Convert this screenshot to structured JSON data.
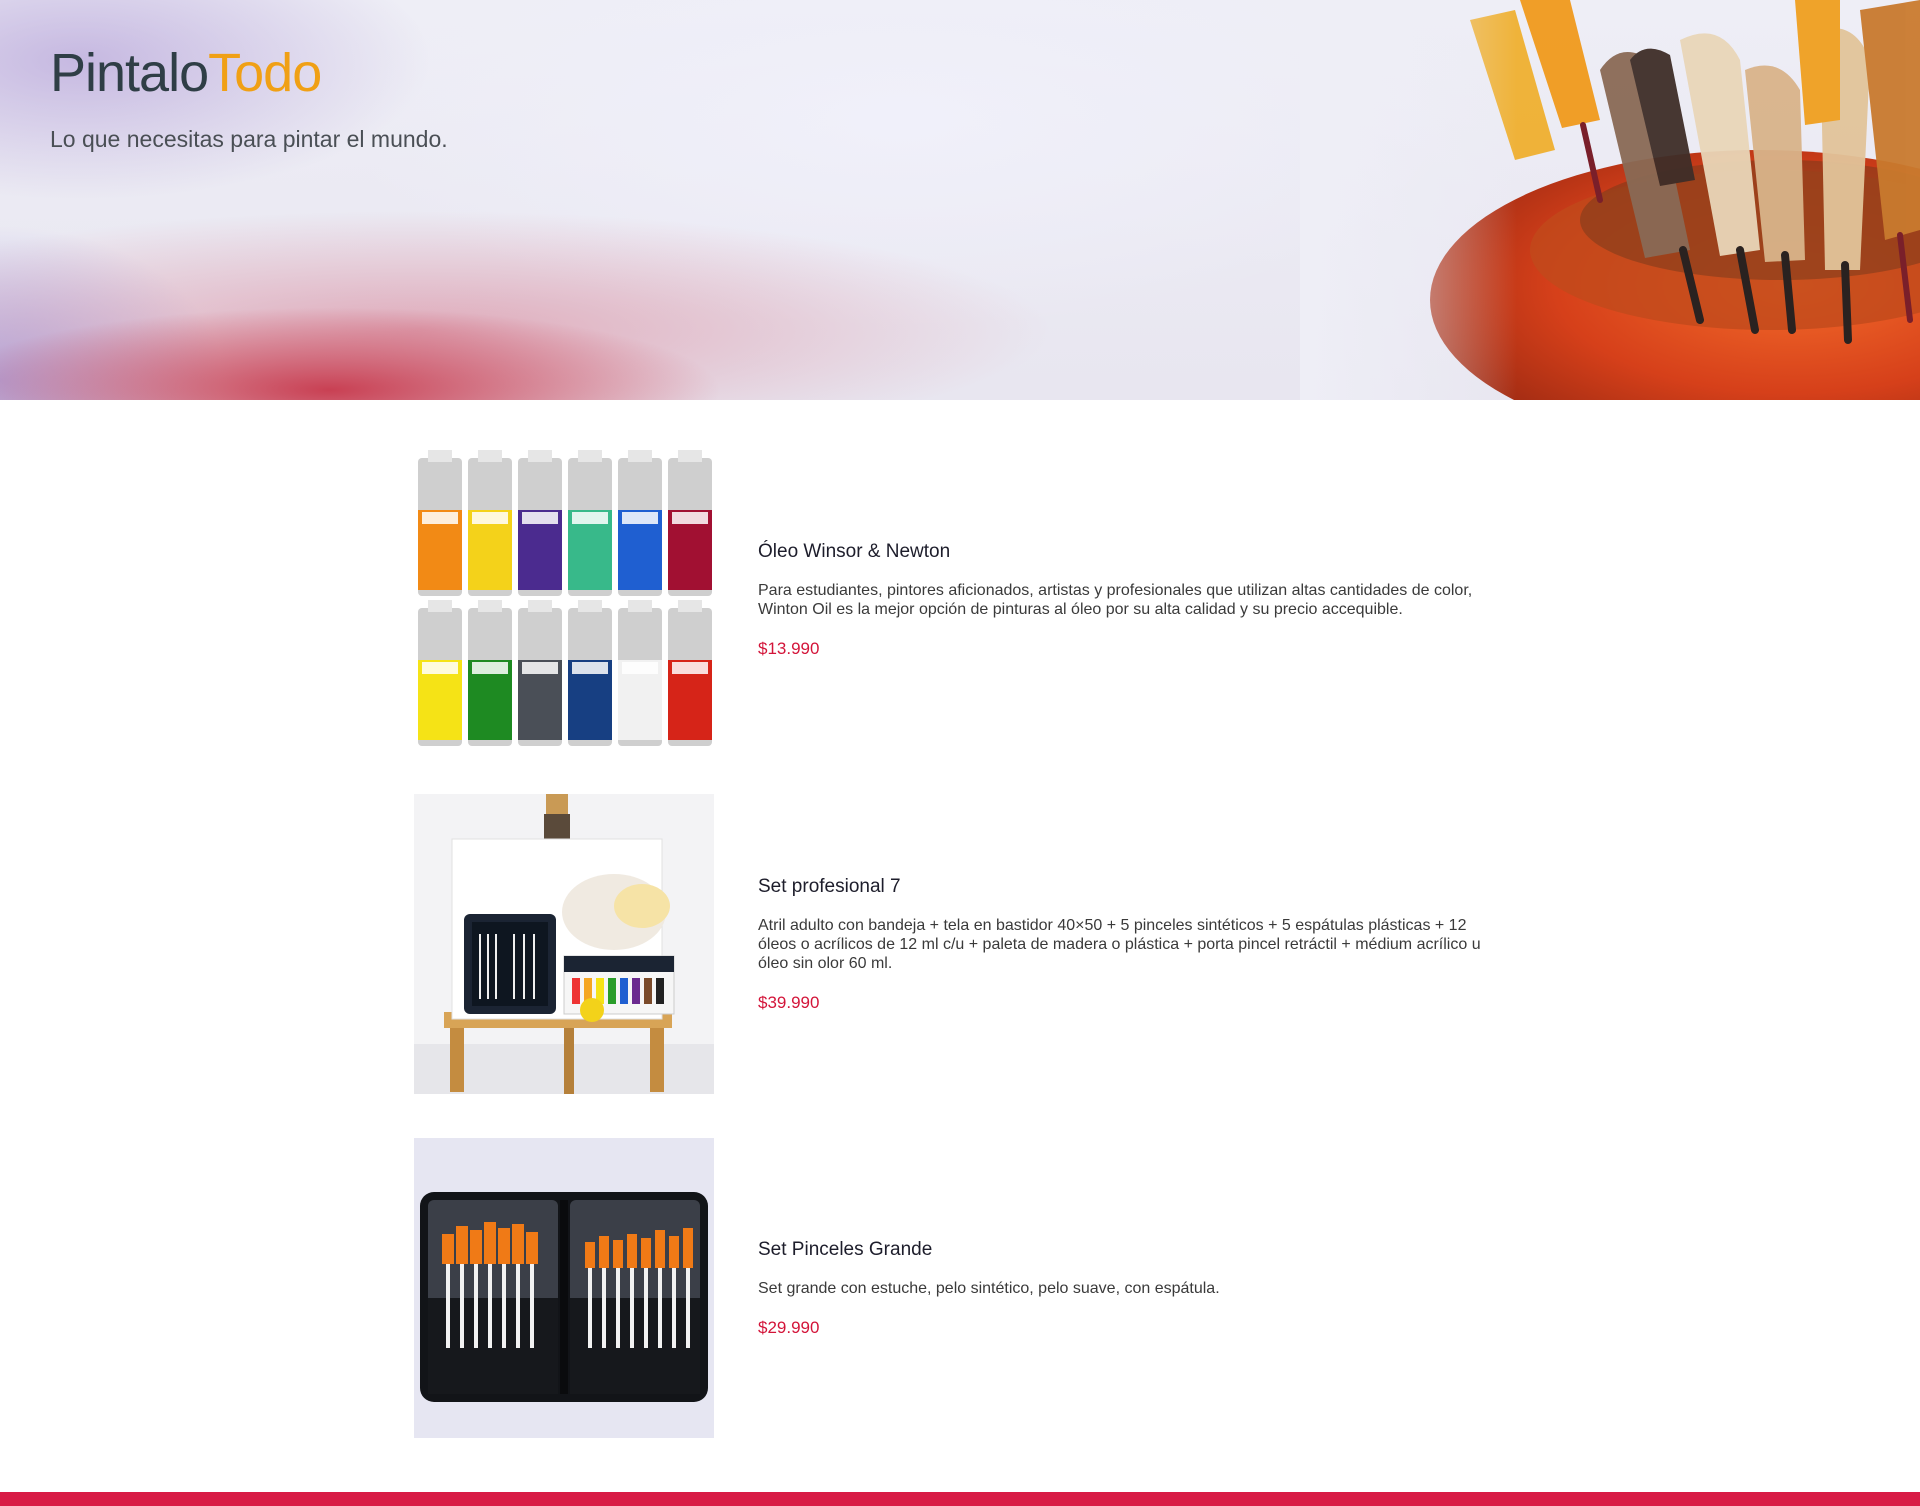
{
  "header": {
    "brand_part1": "Pintalo",
    "brand_part2": "Todo",
    "tagline": "Lo que necesitas para pintar el mundo."
  },
  "products": [
    {
      "title": "Óleo Winsor & Newton",
      "description": "Para estudiantes, pintores aficionados, artistas y profesionales que utilizan altas cantidades de color, Winton Oil es la mejor opción de pinturas al óleo por su alta calidad y su precio accequible.",
      "price": "$13.990",
      "image_icon": "oil-paint-tubes-image"
    },
    {
      "title": "Set profesional 7",
      "description": "Atril adulto con bandeja + tela en bastidor 40×50 + 5 pinceles sintéticos + 5 espátulas plásticas + 12 óleos o acrílicos de 12 ml c/u + paleta de madera o plástica + porta pincel retráctil + médium acrílico u óleo sin olor 60 ml.",
      "price": "$39.990",
      "image_icon": "easel-set-image"
    },
    {
      "title": "Set Pinceles Grande",
      "description": "Set grande con estuche, pelo sintético, pelo suave, con espátula.",
      "price": "$29.990",
      "image_icon": "brush-case-image"
    }
  ],
  "colors": {
    "brand_dark": "#2f3e46",
    "brand_accent": "#f0a015",
    "price": "#d31439",
    "footer_bar": "#d81b45"
  }
}
